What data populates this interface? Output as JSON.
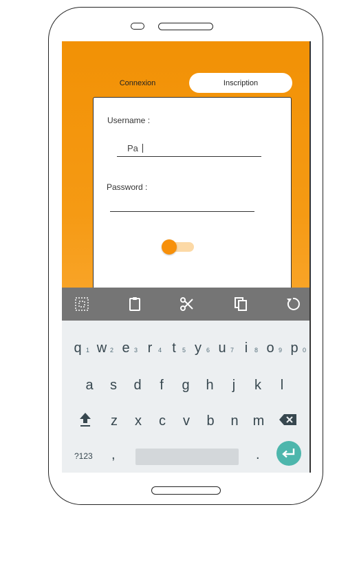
{
  "tabs": {
    "login": "Connexion",
    "signup": "Inscription"
  },
  "form": {
    "username_label": "Username :",
    "username_value": "Pa",
    "password_label": "Password :",
    "password_value": ""
  },
  "toggle": {
    "on": false
  },
  "toolbar": {
    "icons": [
      "select-all-icon",
      "clipboard-icon",
      "cut-icon",
      "copy-icon",
      "undo-icon"
    ]
  },
  "keyboard": {
    "row1": [
      "q",
      "w",
      "e",
      "r",
      "t",
      "y",
      "u",
      "i",
      "o",
      "p"
    ],
    "row1_hints": [
      "1",
      "2",
      "3",
      "4",
      "5",
      "6",
      "7",
      "8",
      "9",
      "0"
    ],
    "row2": [
      "a",
      "s",
      "d",
      "f",
      "g",
      "h",
      "j",
      "k",
      "l"
    ],
    "row3": [
      "z",
      "x",
      "c",
      "v",
      "b",
      "n",
      "m"
    ],
    "symbols_label": "?123",
    "comma": ",",
    "period": "."
  },
  "colors": {
    "accent": "#f29105",
    "enter": "#4db6ac",
    "toolbar": "#757575"
  }
}
